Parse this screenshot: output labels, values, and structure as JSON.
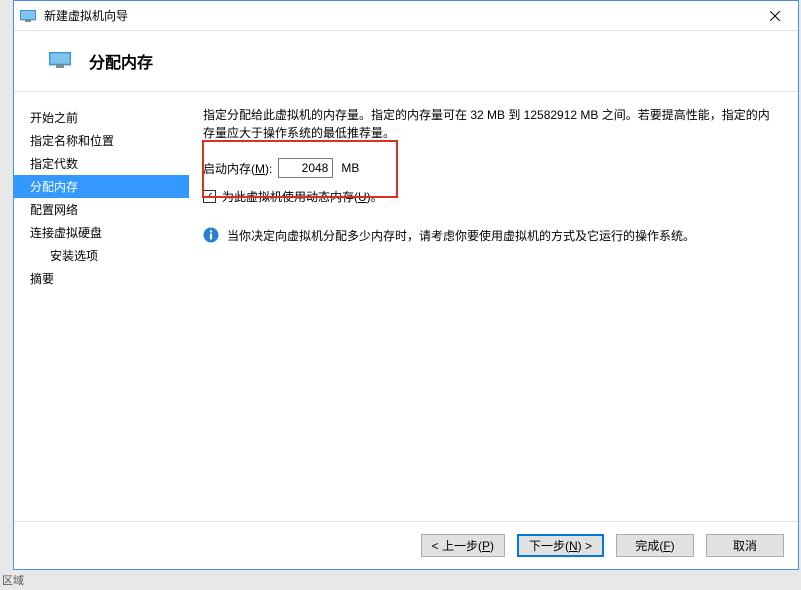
{
  "window": {
    "title": "新建虚拟机向导"
  },
  "header": {
    "title": "分配内存"
  },
  "sidebar": {
    "items": [
      {
        "label": "开始之前",
        "indent": false
      },
      {
        "label": "指定名称和位置",
        "indent": false
      },
      {
        "label": "指定代数",
        "indent": false
      },
      {
        "label": "分配内存",
        "indent": false,
        "active": true
      },
      {
        "label": "配置网络",
        "indent": false
      },
      {
        "label": "连接虚拟硬盘",
        "indent": false
      },
      {
        "label": "安装选项",
        "indent": true
      },
      {
        "label": "摘要",
        "indent": false
      }
    ]
  },
  "content": {
    "description": "指定分配给此虚拟机的内存量。指定的内存量可在 32 MB 到 12582912 MB 之间。若要提高性能，指定的内存量应大于操作系统的最低推荐量。",
    "memory_label_prefix": "启动内存(",
    "memory_label_key": "M",
    "memory_label_suffix": "):",
    "memory_value": "2048",
    "memory_unit": "MB",
    "dynamic_prefix": "为此虚拟机使用动态内存(",
    "dynamic_key": "U",
    "dynamic_suffix": ")。",
    "dynamic_checked": true,
    "info_text": "当你决定向虚拟机分配多少内存时，请考虑你要使用虚拟机的方式及它运行的操作系统。"
  },
  "buttons": {
    "prev_prefix": "< 上一步(",
    "prev_key": "P",
    "prev_suffix": ")",
    "next_prefix": "下一步(",
    "next_key": "N",
    "next_suffix": ") >",
    "finish_prefix": "完成(",
    "finish_key": "F",
    "finish_suffix": ")",
    "cancel": "取消"
  },
  "footer": {
    "fragment": "区域"
  }
}
